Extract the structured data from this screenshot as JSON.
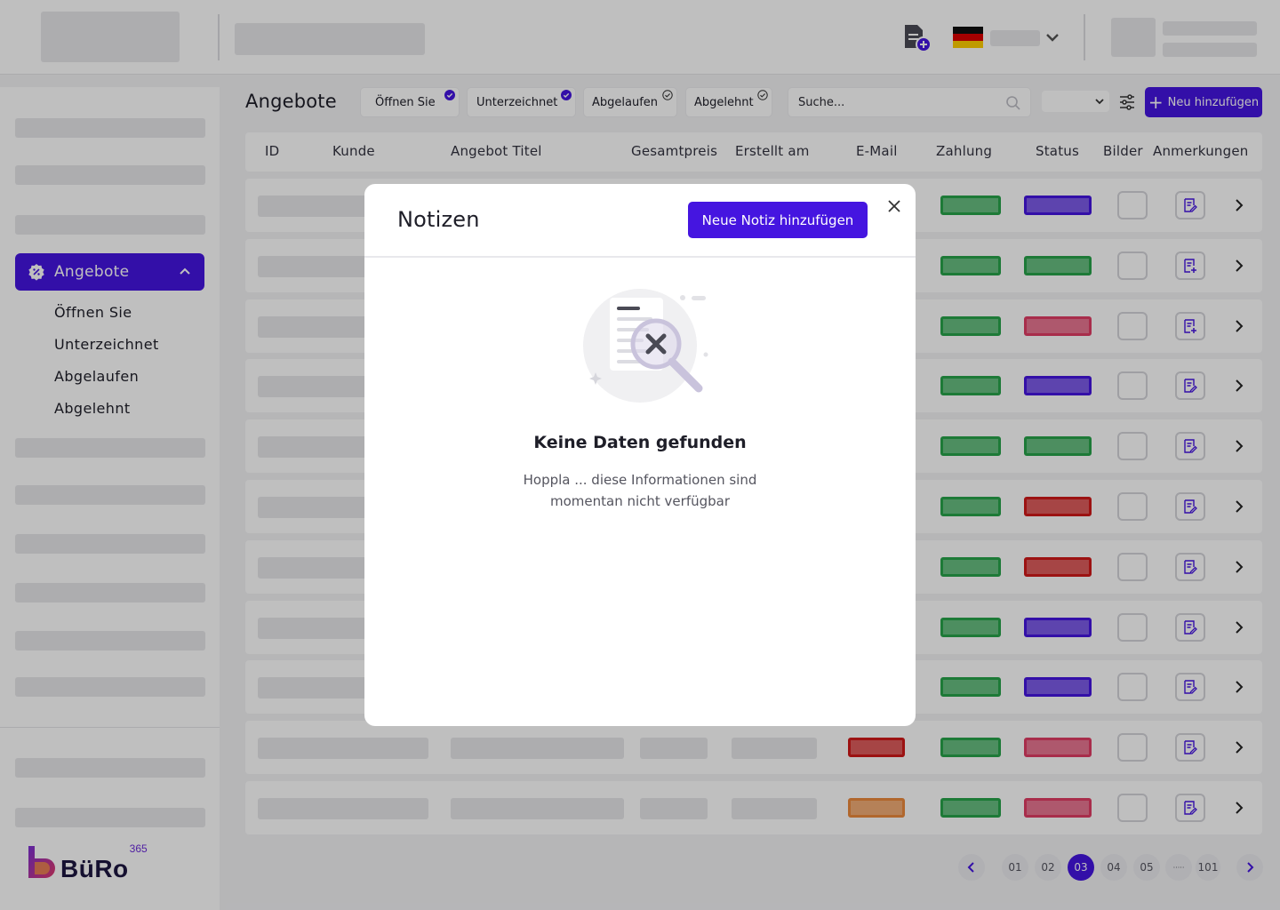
{
  "header": {
    "icons": {
      "doc_add": "document-plus-icon",
      "language_chevron": "chevron-down-icon"
    },
    "flag_colors": [
      "#111111",
      "#dd0000",
      "#ffce00"
    ]
  },
  "sidebar": {
    "active_item": {
      "label": "Angebote",
      "icon": "badge-percent-icon"
    },
    "sub_items": [
      "Öffnen Sie",
      "Unterzeichnet",
      "Abgelaufen",
      "Abgelehnt"
    ],
    "brand": {
      "name": "BüRo",
      "superscript": "365"
    }
  },
  "toolbar": {
    "page_title": "Angebote",
    "filters": [
      "Öffnen Sie",
      "Unterzeichnet",
      "Abgelaufen",
      "Abgelehnt"
    ],
    "search_placeholder": "Suche...",
    "add_button": "Neu hinzufügen",
    "accent_color": "#4515e0"
  },
  "table": {
    "columns": [
      "ID",
      "Kunde",
      "Angebot Titel",
      "Gesamtpreis",
      "Erstellt am",
      "E-Mail",
      "Zahlung",
      "Status",
      "Bilder",
      "Anmerkungen"
    ],
    "status_colors": {
      "green": "#27a34a",
      "purple": "#4515e0",
      "pink": "#e03c64",
      "red": "#d01818",
      "orange": "#ec8a3c"
    },
    "rows": [
      {
        "payment": "green",
        "status": "purple",
        "note_icon": "note-edit-icon"
      },
      {
        "payment": "green",
        "status": "green",
        "note_icon": "note-plus-icon"
      },
      {
        "payment": "green",
        "status": "pink",
        "note_icon": "note-plus-icon"
      },
      {
        "payment": "green",
        "status": "purple",
        "note_icon": "note-edit-icon"
      },
      {
        "payment": "green",
        "status": "green",
        "note_icon": "note-edit-icon"
      },
      {
        "payment": "green",
        "status": "red",
        "note_icon": "note-edit-icon"
      },
      {
        "payment": "green",
        "status": "red",
        "note_icon": "note-edit-icon"
      },
      {
        "payment": "green",
        "status": "purple",
        "note_icon": "note-edit-icon"
      },
      {
        "payment": "green",
        "status": "purple",
        "note_icon": "note-edit-icon"
      },
      {
        "email": "red",
        "payment": "green",
        "status": "pink",
        "note_icon": "note-edit-icon"
      },
      {
        "email": "orange",
        "payment": "green",
        "status": "pink",
        "note_icon": "note-edit-icon"
      }
    ]
  },
  "pagination": {
    "pages": [
      "01",
      "02",
      "03",
      "04",
      "05",
      "·····",
      "101"
    ],
    "current": "03"
  },
  "modal": {
    "title": "Notizen",
    "add_button": "Neue Notiz hinzufügen",
    "close_icon": "close-icon",
    "empty_title": "Keine Daten gefunden",
    "empty_message": "Hoppla ... diese Informationen sind momentan nicht verfügbar"
  }
}
